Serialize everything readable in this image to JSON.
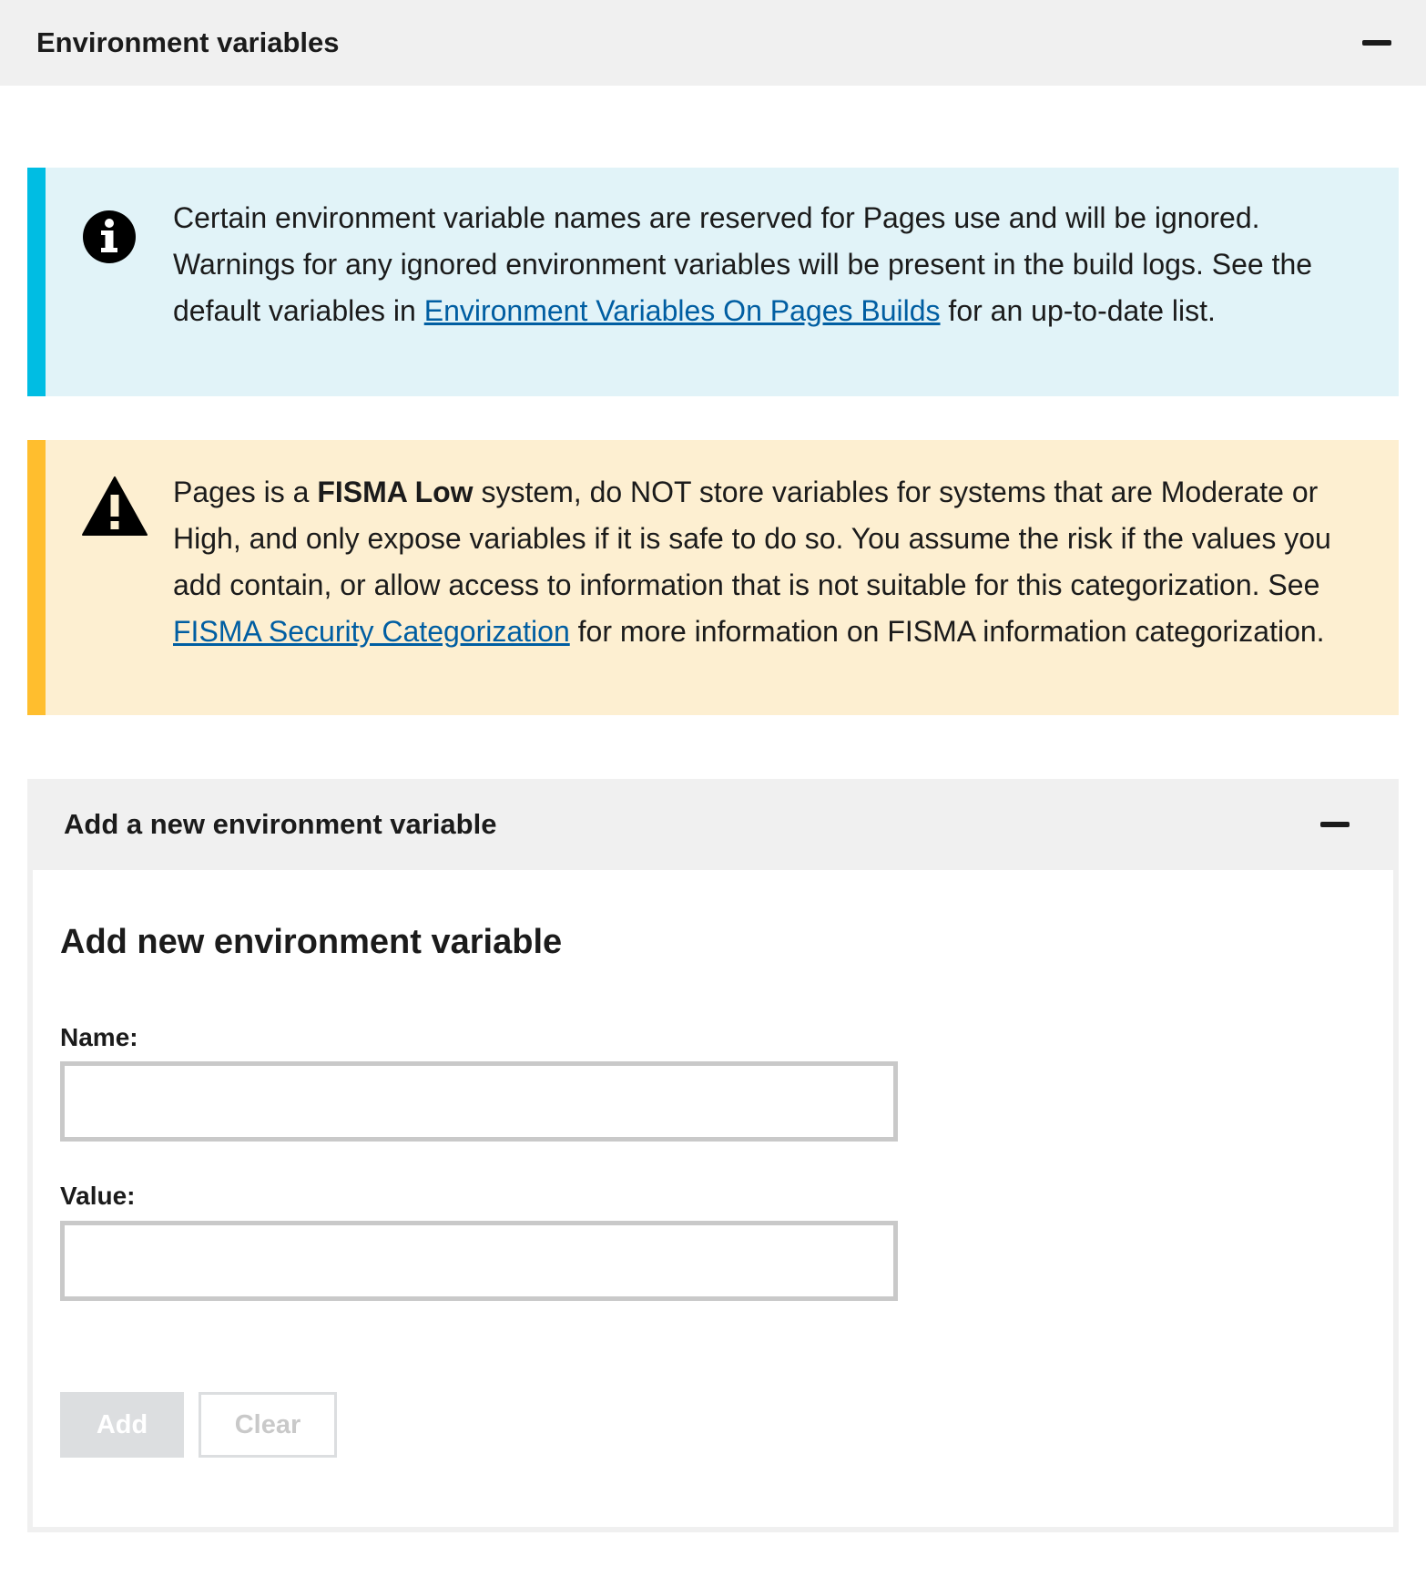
{
  "header": {
    "title": "Environment variables"
  },
  "info_alert": {
    "text_before": "Certain environment variable names are reserved for Pages use and will be ignored. Warnings for any ignored environment variables will be present in the build logs. See the default variables in ",
    "link": "Environment Variables On Pages Builds",
    "text_after": " for an up-to-date list."
  },
  "warning_alert": {
    "text_before": "Pages is a ",
    "bold": "FISMA Low",
    "text_middle": " system, do NOT store variables for systems that are Moderate or High, and only expose variables if it is safe to do so. You assume the risk if the values you add contain, or allow access to information that is not suitable for this categorization. See ",
    "link": "FISMA Security Categorization",
    "text_after": " for more information on FISMA information categorization."
  },
  "add_section": {
    "title": "Add a new environment variable",
    "form_heading": "Add new environment variable",
    "name_label": "Name:",
    "name_value": "",
    "value_label": "Value:",
    "value_value": "",
    "add_button": "Add",
    "clear_button": "Clear"
  },
  "icons": {
    "collapse": "minus-icon",
    "info": "info-icon",
    "warning": "warning-icon"
  },
  "colors": {
    "info_bar": "#00bde3",
    "info_bg": "#e1f3f8",
    "warning_bar": "#ffbe2e",
    "warning_bg": "#fdefd1",
    "link": "#005ea2"
  }
}
